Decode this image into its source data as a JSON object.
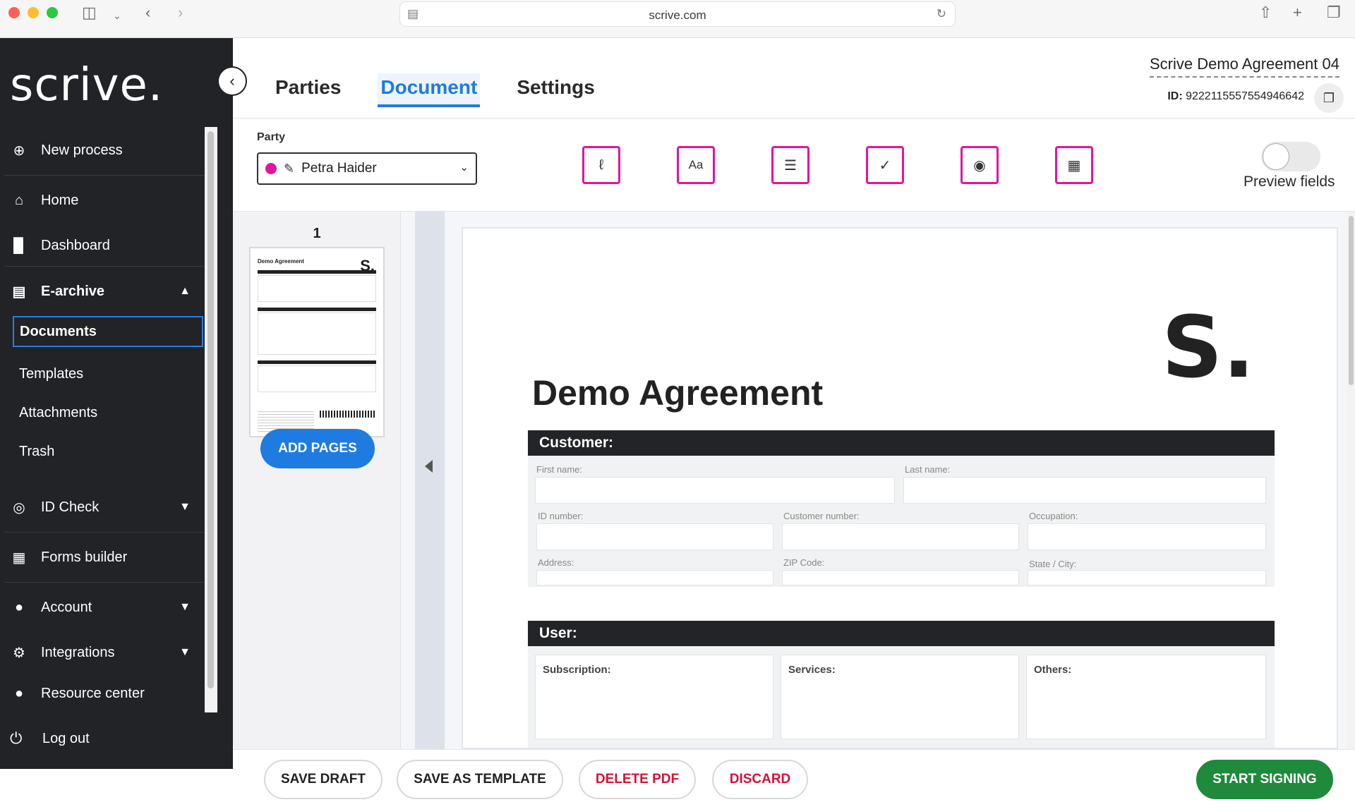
{
  "browser": {
    "url": "scrive.com"
  },
  "sidebar": {
    "logo": "scrive.",
    "items": [
      {
        "label": "New process"
      },
      {
        "label": "Home"
      },
      {
        "label": "Dashboard"
      },
      {
        "label": "E-archive"
      },
      {
        "label": "ID Check"
      },
      {
        "label": "Forms builder"
      },
      {
        "label": "Account"
      },
      {
        "label": "Integrations"
      },
      {
        "label": "Resource center"
      }
    ],
    "earchive_sub": [
      {
        "label": "Documents"
      },
      {
        "label": "Templates"
      },
      {
        "label": "Attachments"
      },
      {
        "label": "Trash"
      }
    ],
    "logout": "Log out"
  },
  "header": {
    "tabs": [
      {
        "label": "Parties"
      },
      {
        "label": "Document"
      },
      {
        "label": "Settings"
      }
    ],
    "doc_title": "Scrive Demo Agreement 04",
    "id_label": "ID:",
    "id_value": "9222115557554946642"
  },
  "toolbar": {
    "party_label": "Party",
    "party_value": "Petra Haider",
    "party_color": "#e0169c",
    "field_tools": [
      "signature-icon",
      "text-icon",
      "textarea-icon",
      "checkbox-icon",
      "radio-icon",
      "date-icon"
    ],
    "text_tool_glyph": "Aa",
    "preview_label": "Preview fields",
    "preview_on": false
  },
  "pages": {
    "page_number": "1",
    "add_pages": "ADD PAGES",
    "thumb_title": "Demo Agreement",
    "thumb_logo": "S."
  },
  "document": {
    "logo": "S.",
    "title": "Demo Agreement",
    "customer_header": "Customer:",
    "customer_fields": {
      "first_name": "First name:",
      "last_name": "Last name:",
      "id_number": "ID number:",
      "customer_number": "Customer number:",
      "occupation": "Occupation:",
      "address": "Address:",
      "zip": "ZIP Code:",
      "state_city": "State / City:"
    },
    "user_header": "User:",
    "user_fields": {
      "subscription": "Subscription:",
      "services": "Services:",
      "others": "Others:"
    }
  },
  "footer": {
    "save_draft": "SAVE DRAFT",
    "save_template": "SAVE AS TEMPLATE",
    "delete_pdf": "DELETE PDF",
    "discard": "DISCARD",
    "start_signing": "START SIGNING"
  },
  "colors": {
    "accent": "#1e7be0",
    "field_tool": "#e0169c",
    "danger": "#d6103d",
    "success": "#1f8a3b",
    "sidebar_bg": "#222327"
  }
}
